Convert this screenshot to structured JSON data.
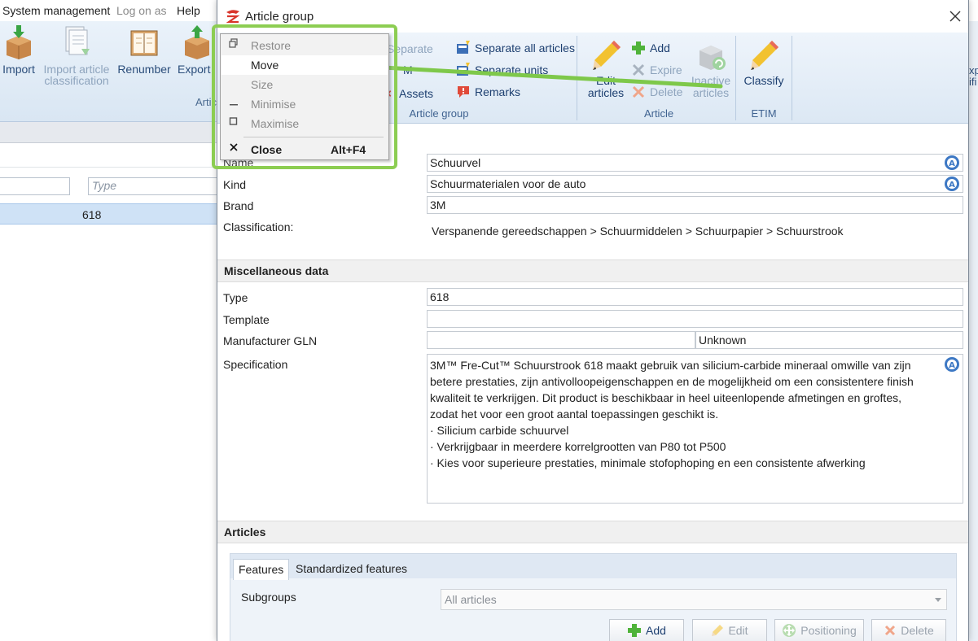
{
  "background": {
    "menubar": [
      "System management",
      "Log on as",
      "Help"
    ],
    "tools": [
      {
        "label": "Import",
        "disabled": false
      },
      {
        "label": "Import article\nclassification",
        "disabled": true
      },
      {
        "label": "Renumber",
        "disabled": false
      },
      {
        "label": "Export",
        "disabled": false
      }
    ],
    "group_label": "Artic",
    "filter_placeholder": "Type",
    "selected_row_value": "618",
    "right_edge_text": "xp\nifi"
  },
  "dialog": {
    "title": "Article group",
    "ribbon": {
      "groups": {
        "article_group": {
          "label": "Article group",
          "items": {
            "separate": "Separate",
            "merge": "M",
            "assets": "Assets",
            "separate_all": "Separate all articles",
            "separate_units": "Separate units",
            "remarks": "Remarks"
          }
        },
        "article": {
          "label": "Article",
          "edit_articles": "Edit\narticles",
          "add": "Add",
          "expire": "Expire",
          "delete": "Delete",
          "inactive_articles": "Inactive\narticles"
        },
        "etim": {
          "label": "ETIM",
          "classify": "Classify"
        }
      }
    },
    "form": {
      "name": {
        "label": "Name",
        "value": "Schuurvel"
      },
      "kind": {
        "label": "Kind",
        "value": "Schuurmaterialen voor de auto"
      },
      "brand": {
        "label": "Brand",
        "value": "3M"
      },
      "classification": {
        "label": "Classification:",
        "value": "Verspanende gereedschappen > Schuurmiddelen > Schuurpapier > Schuurstrook"
      },
      "misc_header": "Miscellaneous data",
      "type": {
        "label": "Type",
        "value": "618"
      },
      "template": {
        "label": "Template",
        "value": ""
      },
      "manufacturer_gln": {
        "label": "Manufacturer GLN",
        "value": "",
        "status": "Unknown"
      },
      "specification": {
        "label": "Specification",
        "lines": [
          "3M™ Fre-Cut™ Schuurstrook 618 maakt gebruik van silicium-carbide mineraal omwille van zijn",
          "betere prestaties, zijn antivolloopeigenschappen en de mogelijkheid om een consistentere finish",
          "kwaliteit te verkrijgen. Dit product is beschikbaar in heel uiteenlopende afmetingen en groftes,",
          "zodat het voor een groot aantal toepassingen geschikt is.",
          "· Silicium carbide schuurvel",
          "· Verkrijgbaar in meerdere korrelgrootten van P80 tot P500",
          "· Kies voor superieure prestaties, minimale stofophoping en een consistente afwerking"
        ]
      },
      "articles_header": "Articles",
      "tabs": [
        "Features",
        "Standardized features"
      ],
      "subgroups": {
        "label": "Subgroups",
        "selected": "All articles"
      },
      "buttons": {
        "add": "Add",
        "edit": "Edit",
        "positioning": "Positioning",
        "delete": "Delete"
      }
    }
  },
  "context_menu": {
    "items": [
      {
        "glyph": "restore",
        "label": "Restore",
        "disabled": true,
        "shortcut": ""
      },
      {
        "glyph": "",
        "label": "Move",
        "disabled": false,
        "shortcut": ""
      },
      {
        "glyph": "",
        "label": "Size",
        "disabled": true,
        "shortcut": ""
      },
      {
        "glyph": "minimise",
        "label": "Minimise",
        "disabled": true,
        "shortcut": ""
      },
      {
        "glyph": "maximise",
        "label": "Maximise",
        "disabled": true,
        "shortcut": ""
      },
      {
        "glyph": "close",
        "label": "Close",
        "disabled": false,
        "shortcut": "Alt+F4"
      }
    ]
  },
  "colors": {
    "highlight_border": "#8ccd52",
    "annotation_arrow": "#7ec84a",
    "ribbon_text": "#1d3f70",
    "selected_row": "#cfe2f6"
  }
}
